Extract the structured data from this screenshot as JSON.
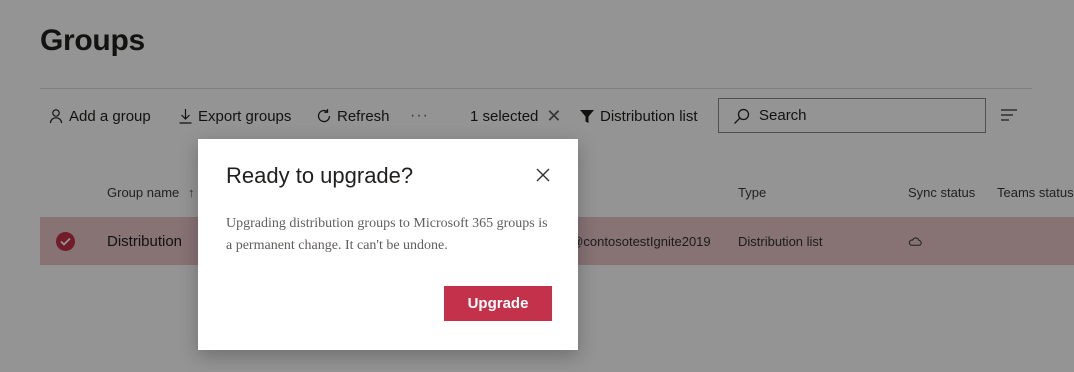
{
  "page": {
    "title": "Groups"
  },
  "toolbar": {
    "add_group": "Add a group",
    "export_groups": "Export groups",
    "refresh": "Refresh",
    "more": "···",
    "selected": "1 selected",
    "clear_selection": "✕",
    "filter": "Distribution list",
    "search_placeholder": "Search"
  },
  "table": {
    "columns": {
      "name": "Group name",
      "sort_indicator": "↑",
      "type": "Type",
      "sync": "Sync status",
      "teams": "Teams status"
    },
    "rows": [
      {
        "name": "Distribution",
        "email": "d@contosotestIgnite2019",
        "type": "Distribution list",
        "sync_icon": "cloud-icon",
        "selected": true
      }
    ]
  },
  "dialog": {
    "title": "Ready to upgrade?",
    "body": "Upgrading distribution groups to Microsoft 365 groups is a permanent change. It can't be undone.",
    "primary_button": "Upgrade"
  },
  "colors": {
    "accent": "#c4314b",
    "selected_row": "#e9c5c9",
    "overlay": "rgba(0,0,0,0.42)"
  }
}
